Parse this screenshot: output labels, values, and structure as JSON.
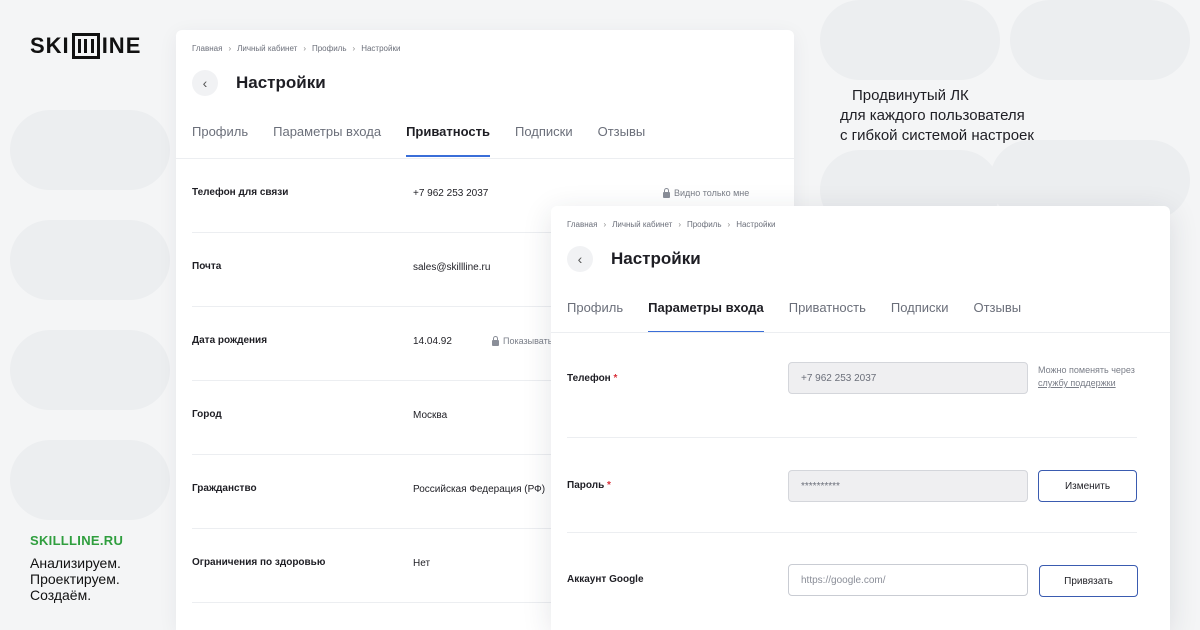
{
  "logo": {
    "text_left": "SKI",
    "text_right": "INE"
  },
  "brand": {
    "url": "SKILLLINE.RU",
    "lines": [
      "Анализируем.",
      "Проектируем.",
      "Создаём."
    ]
  },
  "tagline": [
    "Продвинутый ЛК",
    "для каждого пользователя",
    "с гибкой системой настроек"
  ],
  "card_privacy": {
    "breadcrumb": [
      "Главная",
      "Личный кабинет",
      "Профиль",
      "Настройки"
    ],
    "title": "Настройки",
    "tabs": [
      "Профиль",
      "Параметры входа",
      "Приватность",
      "Подписки",
      "Отзывы"
    ],
    "active_tab": "Приватность",
    "rows": [
      {
        "label": "Телефон для связи",
        "value": "+7 962 253 2037",
        "note": "Видно только мне"
      },
      {
        "label": "Почта",
        "value": "sales@skillline.ru",
        "note": ""
      },
      {
        "label": "Дата рождения",
        "value": "14.04.92",
        "note": "Показывать"
      },
      {
        "label": "Город",
        "value": "Москва",
        "note": ""
      },
      {
        "label": "Гражданство",
        "value": "Российская Федерация (РФ)",
        "note": ""
      },
      {
        "label": "Ограничения по здоровью",
        "value": "Нет",
        "note": ""
      }
    ]
  },
  "card_login": {
    "breadcrumb": [
      "Главная",
      "Личный кабинет",
      "Профиль",
      "Настройки"
    ],
    "title": "Настройки",
    "tabs": [
      "Профиль",
      "Параметры входа",
      "Приватность",
      "Подписки",
      "Отзывы"
    ],
    "active_tab": "Параметры входа",
    "phone": {
      "label": "Телефон",
      "required": "*",
      "value": "+7 962 253 2037",
      "hint": "Можно поменять через",
      "hint_link": "службу поддержки"
    },
    "password": {
      "label": "Пароль",
      "required": "*",
      "value": "**********",
      "button": "Изменить"
    },
    "google": {
      "label": "Аккаунт Google",
      "placeholder": "https://google.com/",
      "button": "Привязать"
    }
  },
  "colors": {
    "accent": "#3a6ed8",
    "brand_green": "#2f9e3e",
    "required": "#d9303a"
  }
}
